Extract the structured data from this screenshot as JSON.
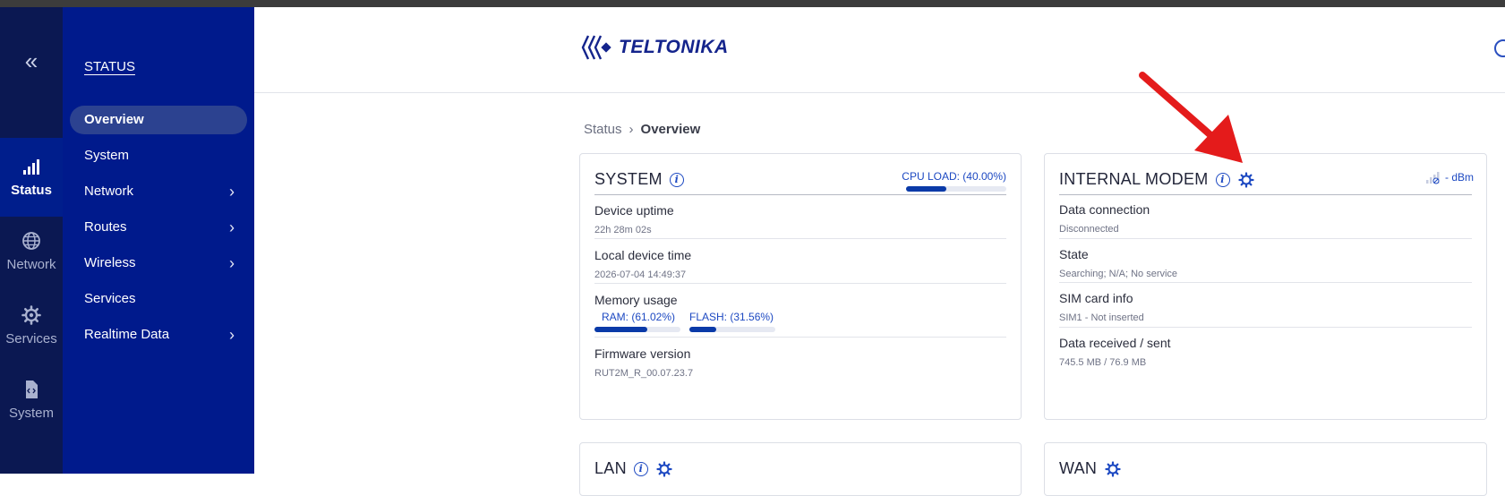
{
  "rail": {
    "collapse_glyph": "«",
    "items": [
      {
        "label": "Status",
        "icon": "signal-bars-icon",
        "active": true
      },
      {
        "label": "Network",
        "icon": "globe-icon",
        "active": false
      },
      {
        "label": "Services",
        "icon": "gear-icon",
        "active": false
      },
      {
        "label": "System",
        "icon": "file-code-icon",
        "active": false
      }
    ]
  },
  "sidebar": {
    "title": "STATUS",
    "items": [
      {
        "label": "Overview",
        "active": true,
        "has_submenu": false
      },
      {
        "label": "System",
        "active": false,
        "has_submenu": false
      },
      {
        "label": "Network",
        "active": false,
        "has_submenu": true
      },
      {
        "label": "Routes",
        "active": false,
        "has_submenu": true
      },
      {
        "label": "Wireless",
        "active": false,
        "has_submenu": true
      },
      {
        "label": "Services",
        "active": false,
        "has_submenu": false
      },
      {
        "label": "Realtime Data",
        "active": false,
        "has_submenu": true
      }
    ]
  },
  "header": {
    "logo_text": "TELTONIKA"
  },
  "breadcrumb": {
    "root": "Status",
    "separator": "›",
    "current": "Overview"
  },
  "system_card": {
    "title": "SYSTEM",
    "cpu_label": "CPU LOAD: (40.00%)",
    "cpu_percent": 40.0,
    "fields": [
      {
        "label": "Device uptime",
        "value": "22h 28m 02s"
      },
      {
        "label": "Local device time",
        "value": "2026-07-04 14:49:37"
      },
      {
        "label": "Memory usage",
        "value": ""
      },
      {
        "label": "Firmware version",
        "value": "RUT2M_R_00.07.23.7"
      }
    ],
    "ram_label": "RAM: (61.02%)",
    "ram_percent": 61.02,
    "flash_label": "FLASH: (31.56%)",
    "flash_percent": 31.56
  },
  "modem_card": {
    "title": "INTERNAL MODEM",
    "signal_text": "- dBm",
    "fields": [
      {
        "label": "Data connection",
        "value": "Disconnected"
      },
      {
        "label": "State",
        "value": "Searching; N/A; No service"
      },
      {
        "label": "SIM card info",
        "value": "SIM1 - Not inserted"
      },
      {
        "label": "Data received / sent",
        "value": "745.5 MB / 76.9 MB"
      }
    ]
  },
  "lan_card": {
    "title": "LAN"
  },
  "wan_card": {
    "title": "WAN"
  },
  "colors": {
    "rail_bg": "#0b1852",
    "sidebar_bg": "#001a8c",
    "accent": "#1d49c2",
    "meter_fill": "#0a3aa8",
    "annotation_arrow": "#e41b1b"
  }
}
